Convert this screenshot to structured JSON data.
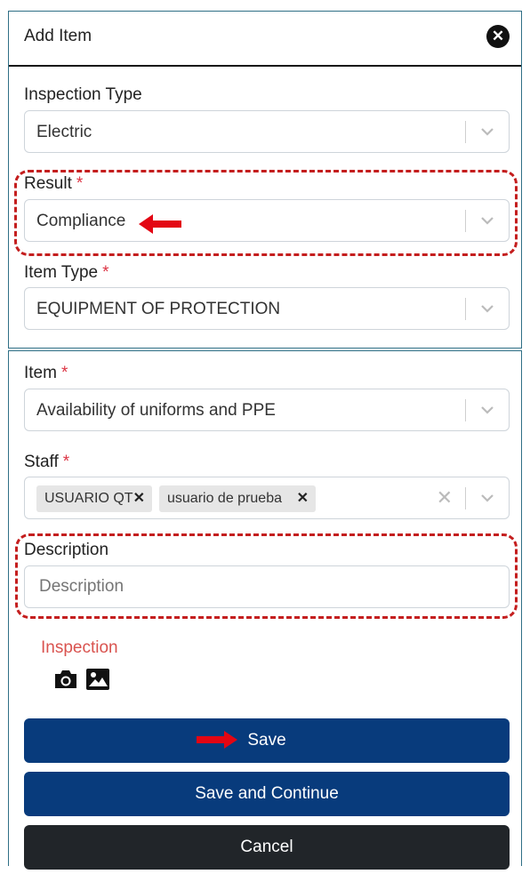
{
  "modal": {
    "title": "Add Item"
  },
  "fields": {
    "inspection_type": {
      "label": "Inspection Type",
      "value": "Electric"
    },
    "result": {
      "label": "Result",
      "required_mark": "*",
      "value": "Compliance"
    },
    "item_type": {
      "label": "Item Type",
      "required_mark": "*",
      "value": "EQUIPMENT OF PROTECTION"
    },
    "item": {
      "label": "Item",
      "required_mark": "*",
      "value": "Availability of uniforms and PPE"
    },
    "staff": {
      "label": "Staff",
      "required_mark": "*",
      "tags": [
        "USUARIO QT",
        "usuario de prueba"
      ]
    },
    "description": {
      "label": "Description",
      "placeholder": "Description"
    }
  },
  "inspection": {
    "label": "Inspection",
    "icons": [
      "camera-icon",
      "image-icon"
    ]
  },
  "buttons": {
    "save": "Save",
    "save_continue": "Save and Continue",
    "cancel": "Cancel"
  },
  "colors": {
    "primary": "#083b7c",
    "dark": "#212529",
    "required": "#dc3545",
    "annotation": "#c41e1e",
    "arrow": "#e30613"
  }
}
